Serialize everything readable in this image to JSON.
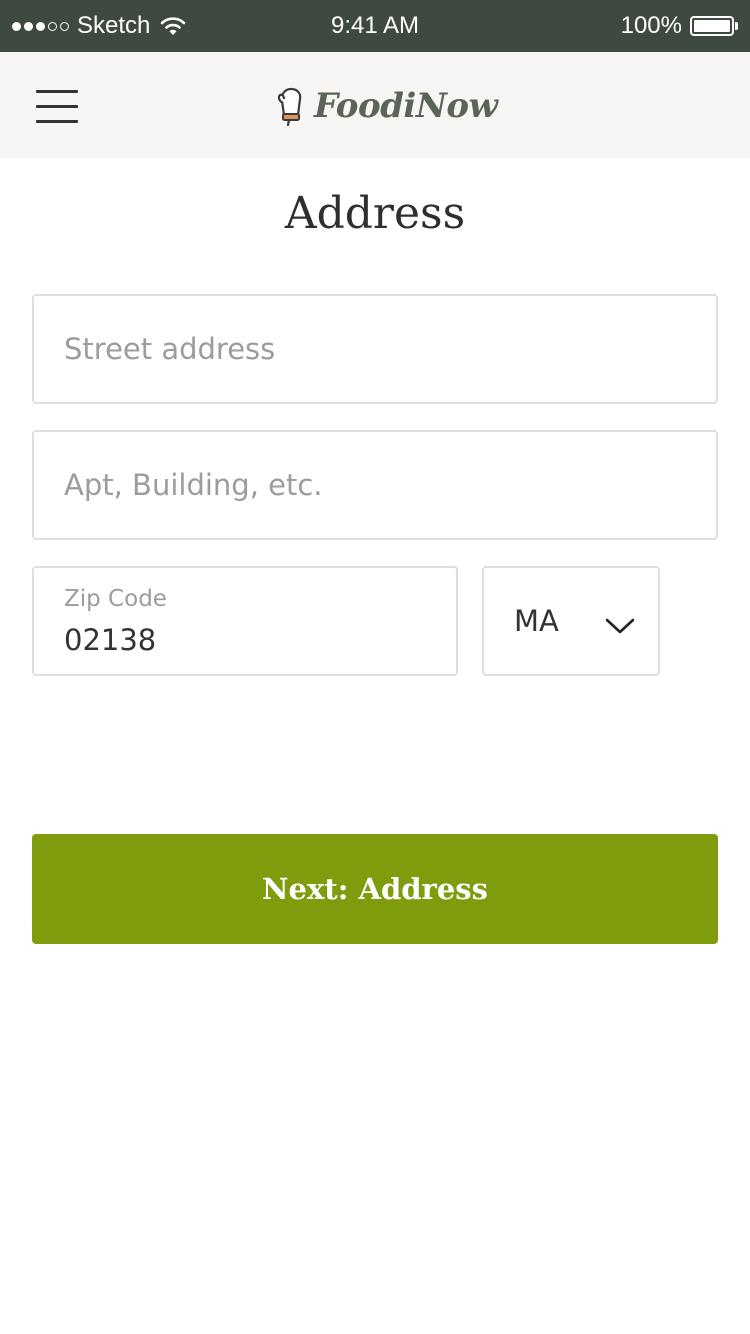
{
  "status_bar": {
    "carrier": "Sketch",
    "time": "9:41 AM",
    "battery": "100%",
    "signal_icon": "signal-dots-icon",
    "wifi_icon": "wifi-icon",
    "battery_icon": "battery-icon"
  },
  "header": {
    "menu_icon": "hamburger-menu-icon",
    "brand_icon": "oven-mitt-icon",
    "brand_name": "FoodiNow"
  },
  "page": {
    "title": "Address"
  },
  "form": {
    "street": {
      "value": "",
      "placeholder": "Street address"
    },
    "apt": {
      "value": "",
      "placeholder": "Apt, Building, etc."
    },
    "zip": {
      "label": "Zip Code",
      "value": "02138"
    },
    "state": {
      "value": "MA",
      "icon": "chevron-down-icon"
    },
    "next_label": "Next: Address"
  },
  "colors": {
    "status_bar_bg": "#3e4a3f",
    "header_bg": "#f7f6f4",
    "brand_text": "#5a6558",
    "accent_green": "#7f9c0d",
    "field_border": "#dedede",
    "placeholder": "#9c9c9c"
  }
}
